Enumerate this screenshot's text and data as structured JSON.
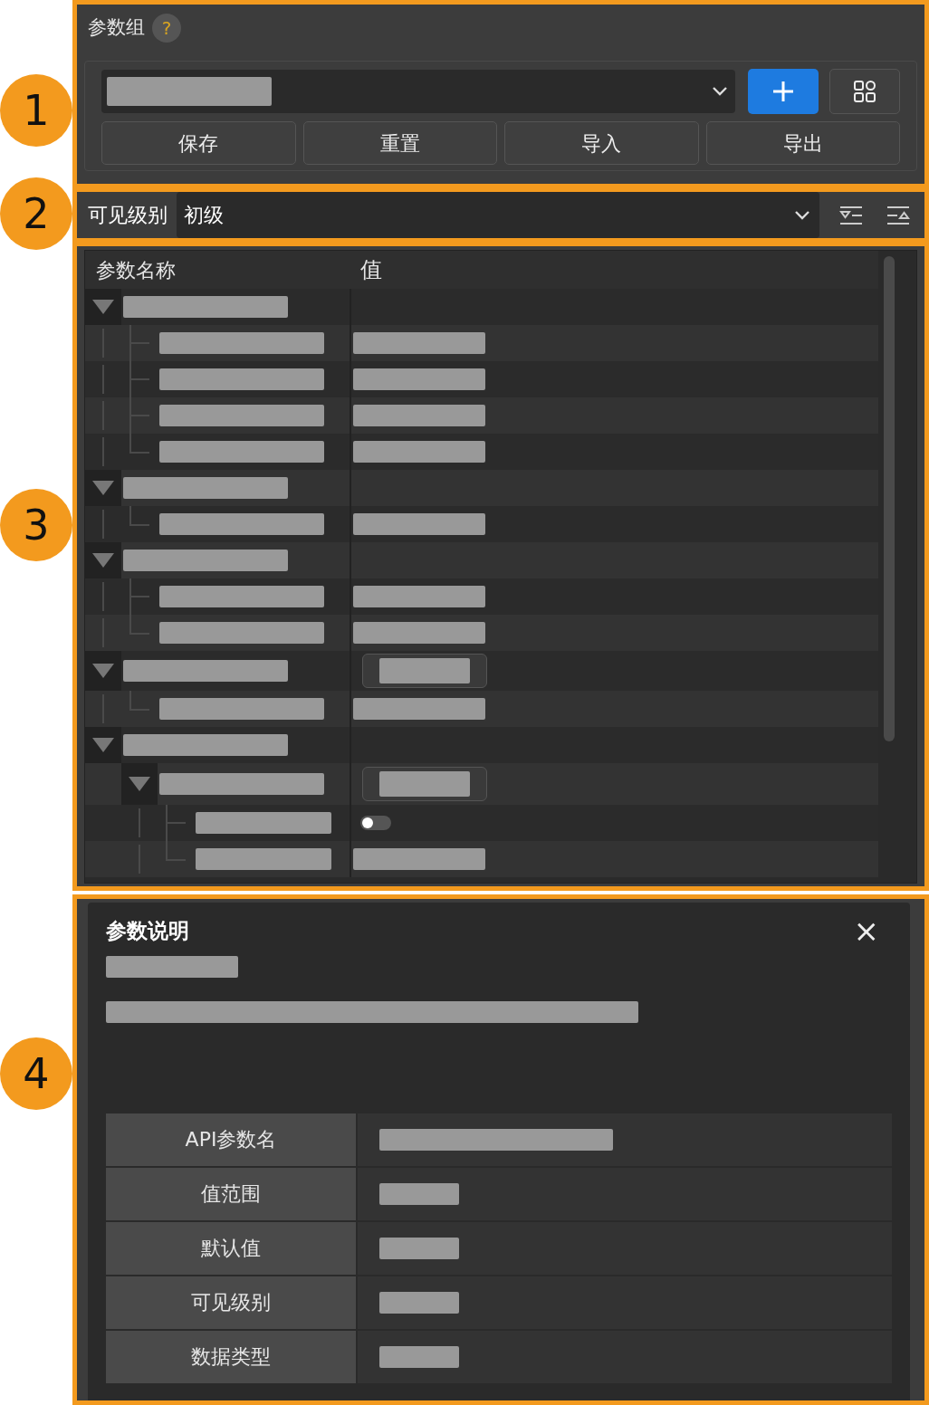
{
  "callouts": [
    {
      "label": "1"
    },
    {
      "label": "2"
    },
    {
      "label": "3"
    },
    {
      "label": "4"
    }
  ],
  "parameter_group": {
    "title": "参数组",
    "help": "?",
    "buttons": [
      "保存",
      "重置",
      "导入",
      "导出"
    ]
  },
  "visibility": {
    "label": "可见级别",
    "value": "初级"
  },
  "tree": {
    "columns": [
      "参数名称",
      "值"
    ],
    "rows": [
      {
        "kind": "group",
        "expanded": true,
        "children": [
          {
            "kind": "text"
          },
          {
            "kind": "text"
          },
          {
            "kind": "text"
          },
          {
            "kind": "text"
          }
        ]
      },
      {
        "kind": "group",
        "expanded": true,
        "children": [
          {
            "kind": "text"
          }
        ]
      },
      {
        "kind": "group",
        "expanded": true,
        "children": [
          {
            "kind": "text"
          },
          {
            "kind": "text"
          }
        ]
      },
      {
        "kind": "choice",
        "expanded": true,
        "children": [
          {
            "kind": "text"
          }
        ]
      },
      {
        "kind": "group",
        "expanded": true,
        "children": [
          {
            "kind": "choice",
            "expanded": true,
            "children": [
              {
                "kind": "switch",
                "on": false
              },
              {
                "kind": "text"
              }
            ]
          }
        ]
      }
    ]
  },
  "description": {
    "title": "参数说明",
    "close": "×",
    "fields": [
      {
        "label": "API参数名",
        "kind": "long"
      },
      {
        "label": "值范围",
        "kind": "short"
      },
      {
        "label": "默认值",
        "kind": "short"
      },
      {
        "label": "可见级别",
        "kind": "short"
      },
      {
        "label": "数据类型",
        "kind": "short"
      }
    ]
  }
}
